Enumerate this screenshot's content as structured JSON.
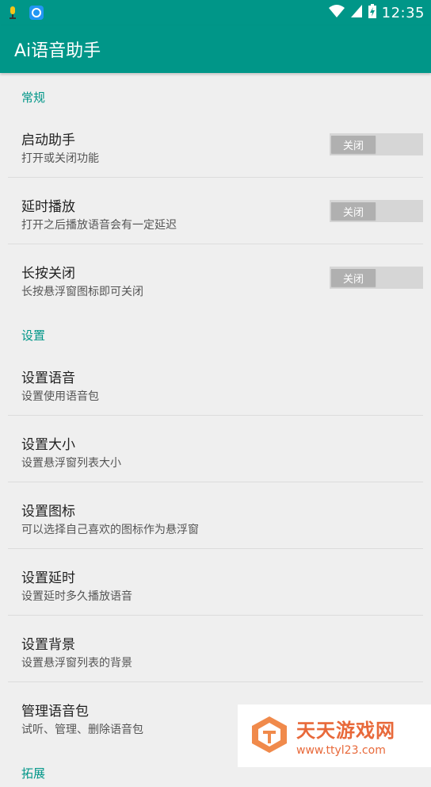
{
  "status_bar": {
    "time": "12:35",
    "icons": [
      "mic-notification-icon",
      "app-notification-icon",
      "wifi-icon",
      "signal-icon",
      "battery-charging-icon"
    ]
  },
  "app_bar": {
    "title": "Ai语音助手"
  },
  "sections": {
    "general": {
      "header": "常规",
      "items": [
        {
          "title": "启动助手",
          "subtitle": "打开或关闭功能",
          "toggle": "关闭"
        },
        {
          "title": "延时播放",
          "subtitle": "打开之后播放语音会有一定延迟",
          "toggle": "关闭"
        },
        {
          "title": "长按关闭",
          "subtitle": "长按悬浮窗图标即可关闭",
          "toggle": "关闭"
        }
      ]
    },
    "settings": {
      "header": "设置",
      "items": [
        {
          "title": "设置语音",
          "subtitle": "设置使用语音包"
        },
        {
          "title": "设置大小",
          "subtitle": "设置悬浮窗列表大小"
        },
        {
          "title": "设置图标",
          "subtitle": "可以选择自己喜欢的图标作为悬浮窗"
        },
        {
          "title": "设置延时",
          "subtitle": "设置延时多久播放语音"
        },
        {
          "title": "设置背景",
          "subtitle": "设置悬浮窗列表的背景"
        },
        {
          "title": "管理语音包",
          "subtitle": "试听、管理、删除语音包"
        }
      ]
    },
    "extend": {
      "header": "拓展"
    }
  },
  "watermark": {
    "name": "天天游戏网",
    "url": "www.ttyl23.com"
  },
  "colors": {
    "accent": "#009688",
    "background": "#efefef",
    "watermark": "#e8693a"
  }
}
